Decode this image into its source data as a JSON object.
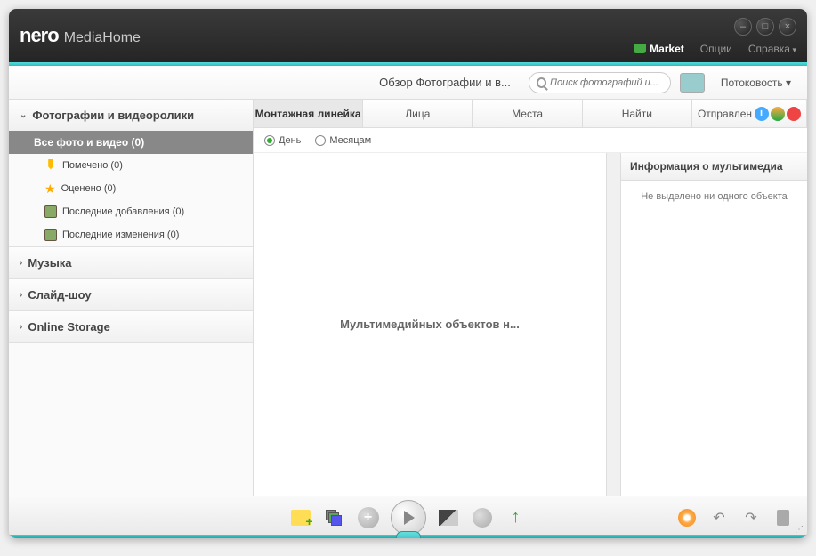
{
  "app": {
    "brand": "nero",
    "product": "MediaHome"
  },
  "menubar": {
    "market": "Market",
    "options": "Опции",
    "help": "Справка"
  },
  "toolbar": {
    "breadcrumb": "Обзор Фотографии и в...",
    "search_placeholder": "Поиск фотографий и...",
    "streaming": "Потоковость ▾"
  },
  "sidebar": {
    "sections": [
      {
        "label": "Фотографии и видеоролики",
        "expanded": true
      },
      {
        "label": "Музыка",
        "expanded": false
      },
      {
        "label": "Слайд-шоу",
        "expanded": false
      },
      {
        "label": "Online Storage",
        "expanded": false
      }
    ],
    "items": [
      {
        "label": "Все фото и видео (0)",
        "active": true
      },
      {
        "label": "Помечено (0)"
      },
      {
        "label": "Оценено (0)"
      },
      {
        "label": "Последние добавления (0)"
      },
      {
        "label": "Последние изменения (0)"
      }
    ]
  },
  "tabs": [
    {
      "label": "Монтажная линейка",
      "active": true
    },
    {
      "label": "Лица"
    },
    {
      "label": "Места"
    },
    {
      "label": "Найти"
    },
    {
      "label": "Отправлен"
    }
  ],
  "filter": {
    "day": "День",
    "month": "Месяцам"
  },
  "canvas": {
    "empty_message": "Мультимедийных объектов н..."
  },
  "info_panel": {
    "title": "Информация о мультимедиа",
    "empty": "Не выделено ни одного объекта"
  }
}
